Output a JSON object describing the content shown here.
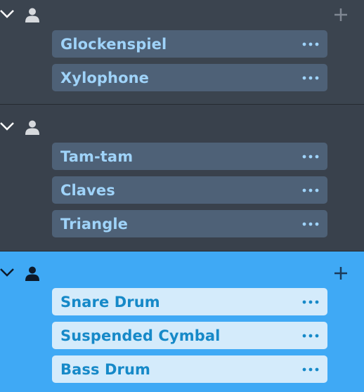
{
  "colors": {
    "panel_dark": "#3b444f",
    "panel_alt": "#39414c",
    "selected_panel": "#3fa9f5",
    "card_dark": "#4e6177",
    "card_dark_text": "#9fd3f9",
    "card_selected": "#d4ebfb",
    "card_selected_text": "#1689c8"
  },
  "icons": {
    "collapse": "chevron-down-icon",
    "player": "person-icon",
    "add": "plus-icon",
    "more": "more-dots-icon"
  },
  "groups": [
    {
      "instruments": [
        {
          "label": "Glockenspiel"
        },
        {
          "label": "Xylophone"
        }
      ]
    },
    {
      "instruments": [
        {
          "label": "Tam-tam"
        },
        {
          "label": "Claves"
        },
        {
          "label": "Triangle"
        }
      ]
    },
    {
      "instruments": [
        {
          "label": "Snare Drum"
        },
        {
          "label": "Suspended Cymbal"
        },
        {
          "label": "Bass Drum"
        }
      ]
    }
  ]
}
